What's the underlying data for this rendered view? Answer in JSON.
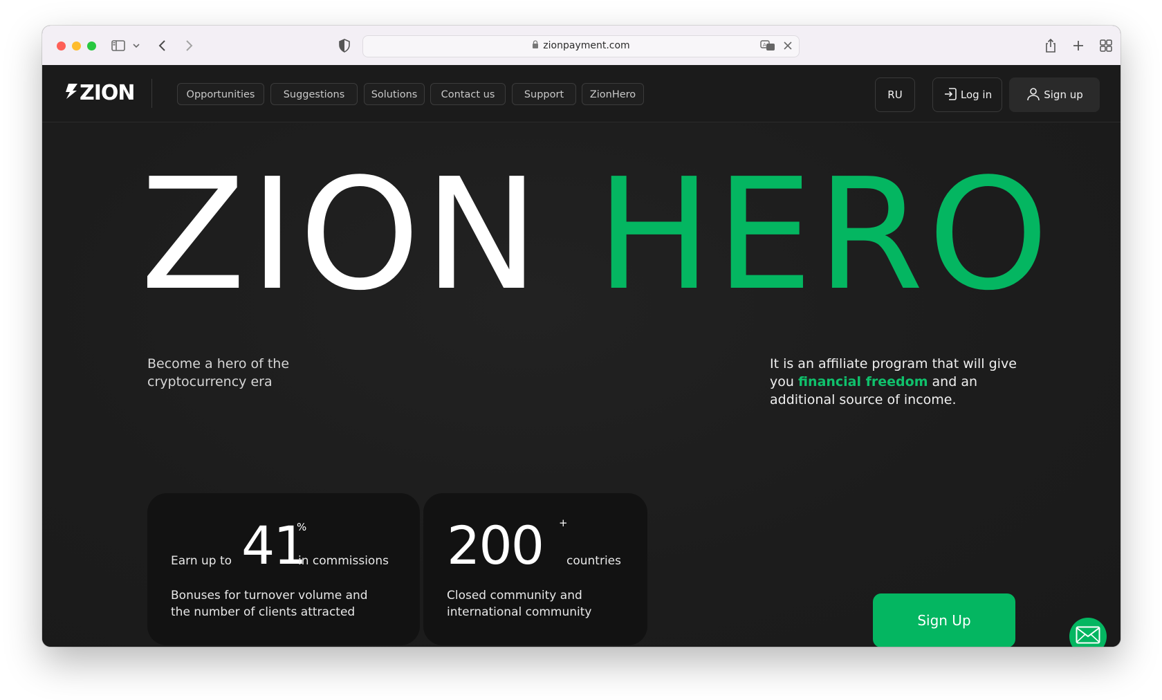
{
  "browser": {
    "url": "zionpayment.com"
  },
  "header": {
    "logo_text": "ZION",
    "nav": [
      {
        "label": "Opportunities"
      },
      {
        "label": "Suggestions"
      },
      {
        "label": "Solutions"
      },
      {
        "label": "Contact us"
      },
      {
        "label": "Support"
      },
      {
        "label": "ZionHero"
      }
    ],
    "lang": "RU",
    "login": "Log in",
    "signup": "Sign up"
  },
  "hero": {
    "title_white": "ZION",
    "title_green": "HERO",
    "tagline": "Become a hero of the cryptocurrency era",
    "desc_before": "It is an affiliate program that will give you ",
    "desc_highlight": "financial freedom",
    "desc_after": " and an additional source of income.",
    "cards": [
      {
        "prefix": "Earn up to",
        "value": "41",
        "sup": "%",
        "suffix": "in commissions",
        "body": "Bonuses for turnover volume and the number of clients attracted"
      },
      {
        "value": "200",
        "sup": "+",
        "suffix": "countries",
        "body": "Closed community and international community"
      }
    ],
    "cta": "Sign Up"
  },
  "colors": {
    "accent": "#04b661",
    "background": "#1c1c1c",
    "card": "#121212"
  },
  "icons": {
    "mail": "mail-icon",
    "login": "login-icon",
    "user": "user-icon"
  }
}
